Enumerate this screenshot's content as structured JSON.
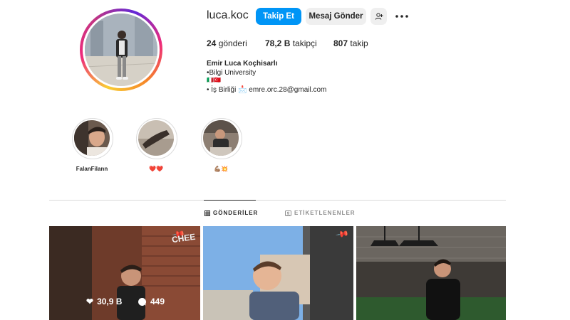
{
  "profile": {
    "username": "luca.koc",
    "follow_label": "Takip Et",
    "message_label": "Mesaj Gönder",
    "stats": {
      "posts_value": "24",
      "posts_label": "gönderi",
      "followers_value": "78,2 B",
      "followers_label": "takipçi",
      "following_value": "807",
      "following_label": "takip"
    },
    "bio": {
      "name": "Emir Luca Koçhisarlı",
      "line1": "•Bilgi University",
      "line2": "🇮🇹🇹🇷",
      "line3": "• İş Birliği 📩 emre.orc.28@gmail.com"
    }
  },
  "highlights": [
    {
      "label": "FalanFilann"
    },
    {
      "label": "❤️❤️"
    },
    {
      "label": "💪🏽💥"
    }
  ],
  "tabs": [
    {
      "label": "GÖNDERİLER",
      "icon": "grid-icon",
      "active": true
    },
    {
      "label": "ETİKETLENENLER",
      "icon": "tag-icon",
      "active": false
    }
  ],
  "posts": [
    {
      "likes": "30,9 B",
      "comments": "449",
      "pinned": true,
      "sign_text": "CHEE"
    },
    {
      "pinned": true
    },
    {
      "pinned": false
    }
  ],
  "colors": {
    "primary_button": "#0095f6",
    "secondary_button": "#efefef",
    "text": "#262626",
    "divider": "#dbdbdb"
  }
}
